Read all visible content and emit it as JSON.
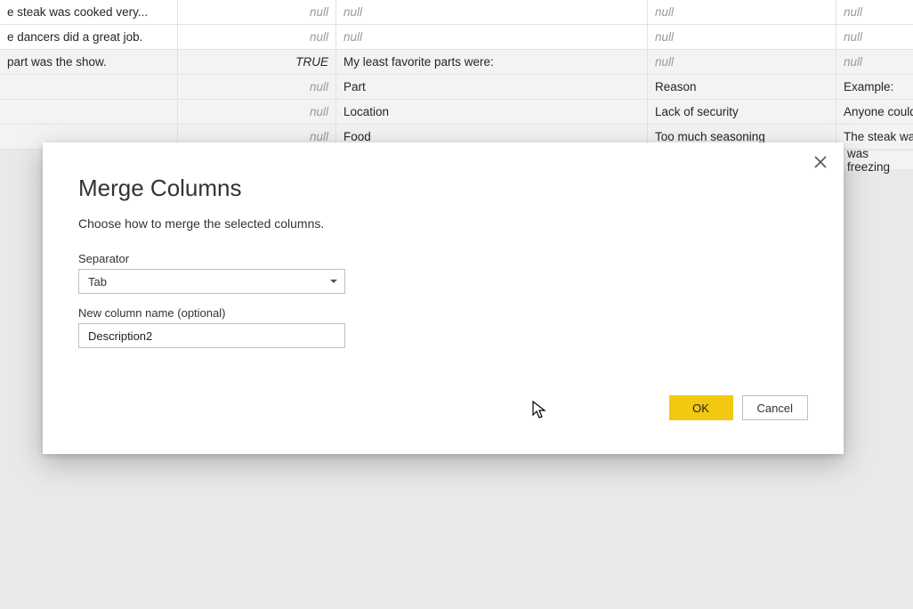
{
  "grid": {
    "rows": [
      {
        "alt": false,
        "c0": "e steak was cooked very...",
        "c1": "null",
        "c1null": true,
        "c2": "null",
        "c2null": true,
        "c3": "null",
        "c3null": true,
        "c4": "null",
        "c4null": true
      },
      {
        "alt": false,
        "c0": "e dancers did a great job.",
        "c1": "null",
        "c1null": true,
        "c2": "null",
        "c2null": true,
        "c3": "null",
        "c3null": true,
        "c4": "null",
        "c4null": true
      },
      {
        "alt": true,
        "c0": " part was the show.",
        "c1": "TRUE",
        "c1null": false,
        "c2": "My least favorite parts were:",
        "c2null": false,
        "c3": "null",
        "c3null": true,
        "c4": "null",
        "c4null": true
      },
      {
        "alt": true,
        "c0": "",
        "c1": "null",
        "c1null": true,
        "c2": "Part",
        "c2null": false,
        "c3": "Reason",
        "c3null": false,
        "c4": "Example:",
        "c4null": false
      },
      {
        "alt": true,
        "c0": "",
        "c1": "null",
        "c1null": true,
        "c2": "Location",
        "c2null": false,
        "c3": "Lack of security",
        "c3null": false,
        "c4": "Anyone could",
        "c4null": false
      },
      {
        "alt": true,
        "c0": "",
        "c1": "null",
        "c1null": true,
        "c2": "Food",
        "c2null": false,
        "c3": "Too much seasoning",
        "c3null": false,
        "c4": "The steak wa",
        "c4null": false
      }
    ],
    "overflow_text": "was freezing"
  },
  "dialog": {
    "title": "Merge Columns",
    "subtitle": "Choose how to merge the selected columns.",
    "separator_label": "Separator",
    "separator_value": "Tab",
    "newname_label": "New column name (optional)",
    "newname_value": "Description2",
    "ok": "OK",
    "cancel": "Cancel"
  }
}
